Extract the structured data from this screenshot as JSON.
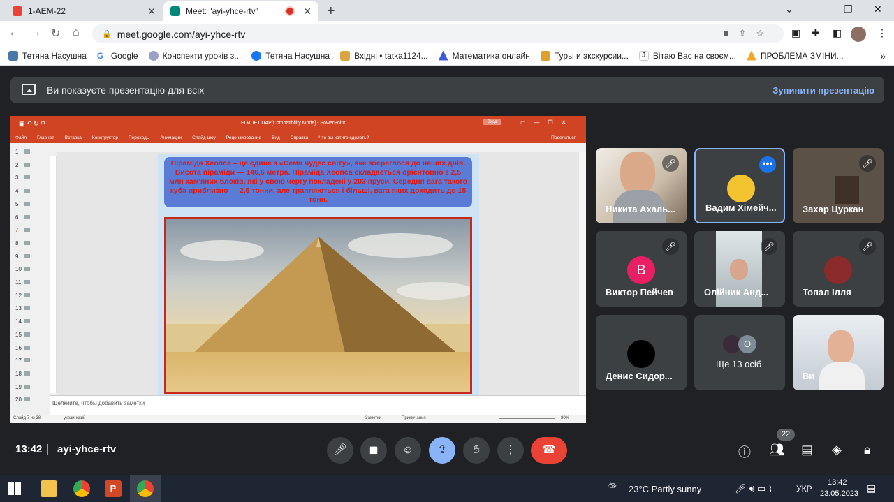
{
  "tabs": [
    {
      "title": "1-AEM-22"
    },
    {
      "title": "Meet: \"ayi-yhce-rtv\""
    }
  ],
  "address": {
    "url": "meet.google.com/ayi-yhce-rtv"
  },
  "bookmarks": [
    "Тетяна Насушна",
    "Google",
    "Конспекти уроків з...",
    "Тетяна Насушна",
    "Вхідні • tatka1124...",
    "Математика онлайн",
    "Туры и экскурсии...",
    "Вітаю Вас на своєм...",
    "ПРОБЛЕМА ЗМІНИ..."
  ],
  "banner": {
    "text": "Ви показуєте презентацію для всіх",
    "stop": "Зупинити презентацію"
  },
  "ppt": {
    "title": "ЕГИПЕТ ПАР[Compatibility Mode] - PowerPoint",
    "login": "Вход",
    "menu": [
      "Файл",
      "Главная",
      "Вставка",
      "Конструктор",
      "Переходы",
      "Анимации",
      "Слайд-шоу",
      "Рецензирование",
      "Вид",
      "Справка",
      "Что вы хотите сделать?",
      "Поделиться"
    ],
    "slide_text": "Піраміда Хеопса – це єдине з «Семи чудес світу», яке збереглося до наших днів. Висота піраміди — 146,6 метра. Піраміда Хеопса складається  орієнтовно з 2,5 млн кам'яних блоків, які у свою чергу покладені у 203 яруси. Середня вага такого куба приблизно — 2,5 тонни, але трапляються і більші, вага яких доходить до 15 тонн.",
    "notes": "Щелкните, чтобы добавить заметки",
    "status_left": "Слайд 7 из 38",
    "status_lang": "украинский",
    "status_notes": "Заметки",
    "status_comments": "Примечания",
    "zoom": "80%",
    "thumb_numbers": [
      "1",
      "2",
      "3",
      "4",
      "5",
      "6",
      "7",
      "8",
      "9",
      "10",
      "11",
      "12",
      "13",
      "14",
      "15",
      "16",
      "17",
      "18",
      "19",
      "20"
    ]
  },
  "participants": [
    {
      "name": "Никита Ахаль...",
      "initial": ""
    },
    {
      "name": "Вадим Хімейч...",
      "initial": ""
    },
    {
      "name": "Захар Цуркан",
      "initial": ""
    },
    {
      "name": "Виктор Пейчев",
      "initial": "В"
    },
    {
      "name": "Олійник Анд...",
      "initial": ""
    },
    {
      "name": "Топал Ілля",
      "initial": ""
    },
    {
      "name": "Денис Сидор...",
      "initial": ""
    },
    {
      "name": "Ще 13 осіб",
      "initial": "О"
    },
    {
      "name": "Ви",
      "initial": ""
    }
  ],
  "meeting": {
    "time": "13:42",
    "code": "ayi-yhce-rtv",
    "people_count": "22"
  },
  "taskbar": {
    "weather": "23°C  Partly sunny",
    "lang": "УКР",
    "time": "13:42",
    "date": "23.05.2023"
  }
}
